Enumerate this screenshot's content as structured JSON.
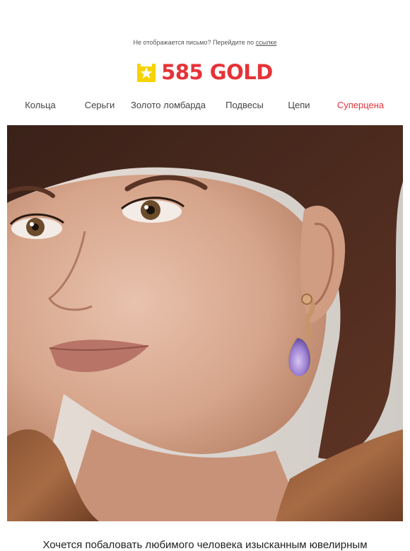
{
  "preheader": {
    "text": "Не отображается письмо? Перейдите по",
    "link_label": "ссылке"
  },
  "logo": {
    "text": "585 GOLD",
    "mark_icon": "star-bag-icon",
    "colors": {
      "text": "#e63338",
      "mark": "#f7d300"
    }
  },
  "nav": {
    "items": [
      {
        "label": "Кольца"
      },
      {
        "label": "Серьги"
      },
      {
        "label": "Золото ломбарда"
      },
      {
        "label": "Подвесы"
      },
      {
        "label": "Цепи"
      },
      {
        "label": "Суперцена"
      }
    ],
    "accent_color": "#e63338"
  },
  "hero": {
    "alt": "Woman wearing rose gold earring with purple stone"
  },
  "body": {
    "intro": "Хочется побаловать любимого человека изысканным ювелирным"
  }
}
